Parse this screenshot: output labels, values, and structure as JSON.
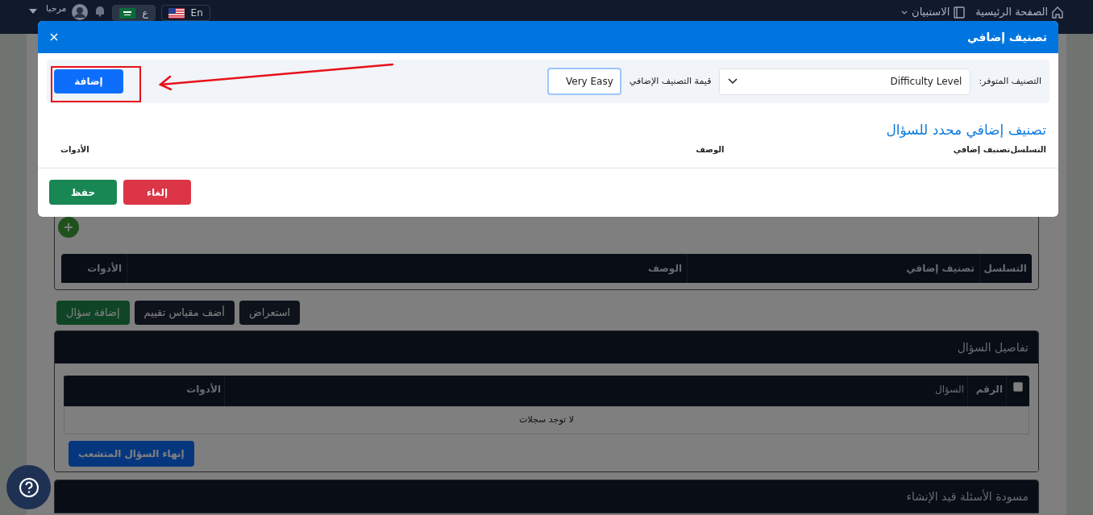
{
  "header": {
    "nav": [
      {
        "label": "الصفحة الرئيسية",
        "kind": "home"
      },
      {
        "label": "الاستبيان",
        "kind": "menu"
      }
    ],
    "user": {
      "greeting": "مرحبا"
    },
    "languages": [
      {
        "label": "En",
        "kind": "us",
        "selected": false
      },
      {
        "label": "ع",
        "kind": "sa",
        "selected": true
      }
    ]
  },
  "background": {
    "criteria_columns": [
      "التسلسل",
      "تصنيف إضافي",
      "الوصف",
      "الأدوات"
    ],
    "actions": [
      {
        "label": "استعراض",
        "kind": "dark"
      },
      {
        "label": "أضف مقياس تقييم",
        "kind": "dark"
      },
      {
        "label": "إضافة سؤال",
        "kind": "green"
      }
    ],
    "details_panel": {
      "title": "تفاصيل السؤال",
      "select_all_checked": false,
      "columns": [
        "الرقم",
        "السؤال",
        "الأدوات"
      ],
      "empty": "لا توجد سجلات",
      "button": "إنهاء السؤال المتشعب"
    },
    "draft_panel": {
      "title": "مسودة الأسئلة قيد الإنشاء"
    }
  },
  "modal": {
    "title": "تصنيف إضافي",
    "category_label": "التصنيف المتوفر:",
    "category_value": "Difficulty Level",
    "value_label": "قيمة التصنيف الإضافي",
    "value": "Very Easy",
    "add_button": "إضافة",
    "section_title": "تصنيف إضافي محدد للسؤال",
    "columns": [
      "التسلسل",
      "تصنيف إضافي",
      "الوصف",
      "الأدوات"
    ],
    "buttons": [
      {
        "label": "إلغاء",
        "kind": "danger"
      },
      {
        "label": "حفظ",
        "kind": "success"
      }
    ]
  }
}
